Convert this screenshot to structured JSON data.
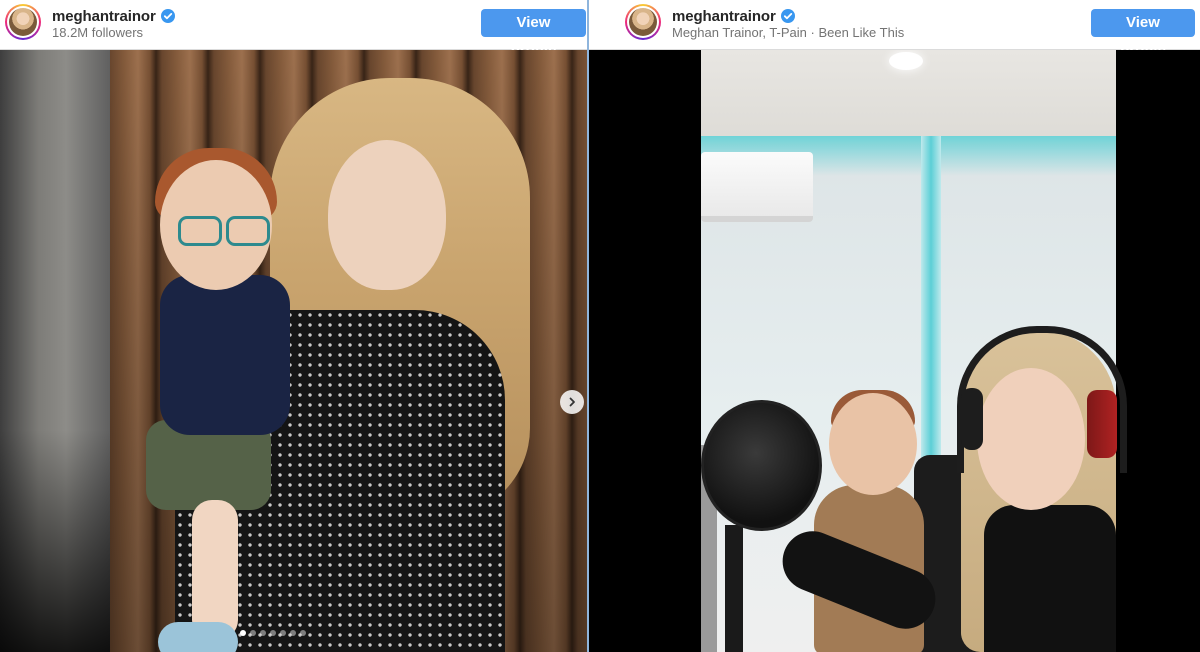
{
  "left_embed": {
    "username": "meghantrainor",
    "subline": "18.2M followers",
    "view_profile": "View profile",
    "carousel": {
      "total_slides": 7,
      "active_index": 0
    }
  },
  "right_embed": {
    "username": "meghantrainor",
    "subline": "Meghan Trainor, T-Pain · Been Like This",
    "view_profile": "View profile"
  },
  "icons": {
    "verified": "verified-badge-icon",
    "next": "chevron-right-icon"
  },
  "colors": {
    "button": "#4c98ee",
    "verified": "#3897f0",
    "divider": "#8fb5dc",
    "username": "#262626",
    "subline": "#737373"
  }
}
